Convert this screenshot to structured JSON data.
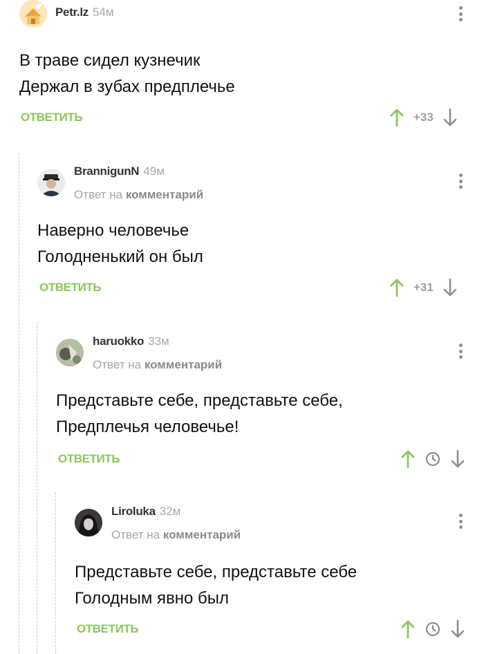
{
  "comments": [
    {
      "username": "Petr.lz",
      "time": "54м",
      "lines": [
        "В траве сидел кузнечик",
        "Держал в зубах предплечье"
      ],
      "reply_label": "ОТВЕТИТЬ",
      "rating": "+33",
      "avatar_icon": "house-cat-avatar"
    },
    {
      "username": "BrannigunN",
      "time": "49м",
      "reply_prefix": "Ответ на",
      "reply_target": "комментарий",
      "lines": [
        "Наверно человечье",
        "Голодненький он был"
      ],
      "reply_label": "ОТВЕТИТЬ",
      "rating": "+31",
      "avatar_icon": "uniformed-man-avatar"
    },
    {
      "username": "haruokko",
      "time": "33м",
      "reply_prefix": "Ответ на",
      "reply_target": "комментарий",
      "lines": [
        "Представьте себе, представьте себе,",
        "Предплечья человечье!"
      ],
      "reply_label": "ОТВЕТИТЬ",
      "rating_icon": "clock-icon",
      "avatar_icon": "photo-avatar"
    },
    {
      "username": "Liroluka",
      "time": "32м",
      "reply_prefix": "Ответ на",
      "reply_target": "комментарий",
      "lines": [
        "Представьте себе, представьте себе",
        "Голодным явно был"
      ],
      "reply_label": "ОТВЕТИТЬ",
      "rating_icon": "clock-icon",
      "avatar_icon": "dark-girl-avatar"
    }
  ],
  "colors": {
    "accent_green": "#8ac858",
    "muted_gray": "#a5a5a5",
    "thread_line": "#c9c9c9"
  }
}
